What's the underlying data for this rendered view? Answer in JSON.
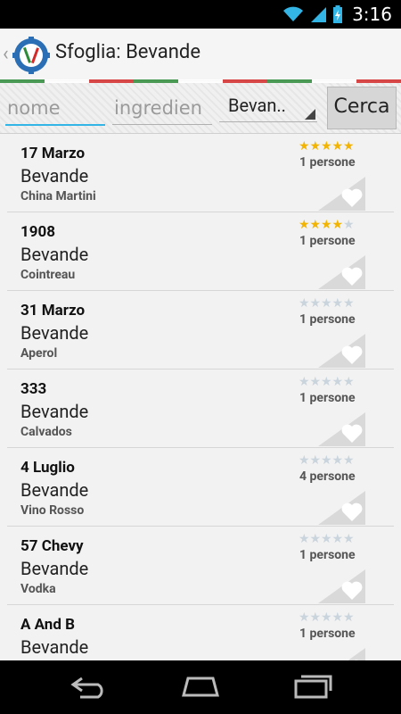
{
  "status_bar": {
    "time": "3:16"
  },
  "action_bar": {
    "title": "Sfoglia: Bevande"
  },
  "search": {
    "name_placeholder": "nome",
    "ingredient_placeholder": "ingredien",
    "category_selected": "Bevan..",
    "button_label": "Cerca"
  },
  "items": [
    {
      "name": "17 Marzo",
      "category": "Bevande",
      "ingredient": "China Martini",
      "rating": 5,
      "persone": "1 persone"
    },
    {
      "name": "1908",
      "category": "Bevande",
      "ingredient": "Cointreau",
      "rating": 4,
      "persone": "1 persone"
    },
    {
      "name": "31 Marzo",
      "category": "Bevande",
      "ingredient": "Aperol",
      "rating": 0,
      "persone": "1 persone"
    },
    {
      "name": "333",
      "category": "Bevande",
      "ingredient": "Calvados",
      "rating": 0,
      "persone": "1 persone"
    },
    {
      "name": "4 Luglio",
      "category": "Bevande",
      "ingredient": "Vino Rosso",
      "rating": 0,
      "persone": "4 persone"
    },
    {
      "name": "57 Chevy",
      "category": "Bevande",
      "ingredient": "Vodka",
      "rating": 0,
      "persone": "1 persone"
    },
    {
      "name": "A And B",
      "category": "Bevande",
      "ingredient": "",
      "rating": 0,
      "persone": "1 persone"
    }
  ],
  "icons": {
    "wifi": "wifi-icon",
    "signal": "signal-icon",
    "battery": "battery-charging-icon",
    "app_logo": "gear-cutlery-icon",
    "favorite": "heart-icon",
    "back": "back-arrow-icon",
    "home": "home-icon",
    "recents": "recent-apps-icon"
  },
  "colors": {
    "accent": "#33b5e5",
    "star_on": "#f2b400",
    "star_off": "#c9d4dc"
  }
}
